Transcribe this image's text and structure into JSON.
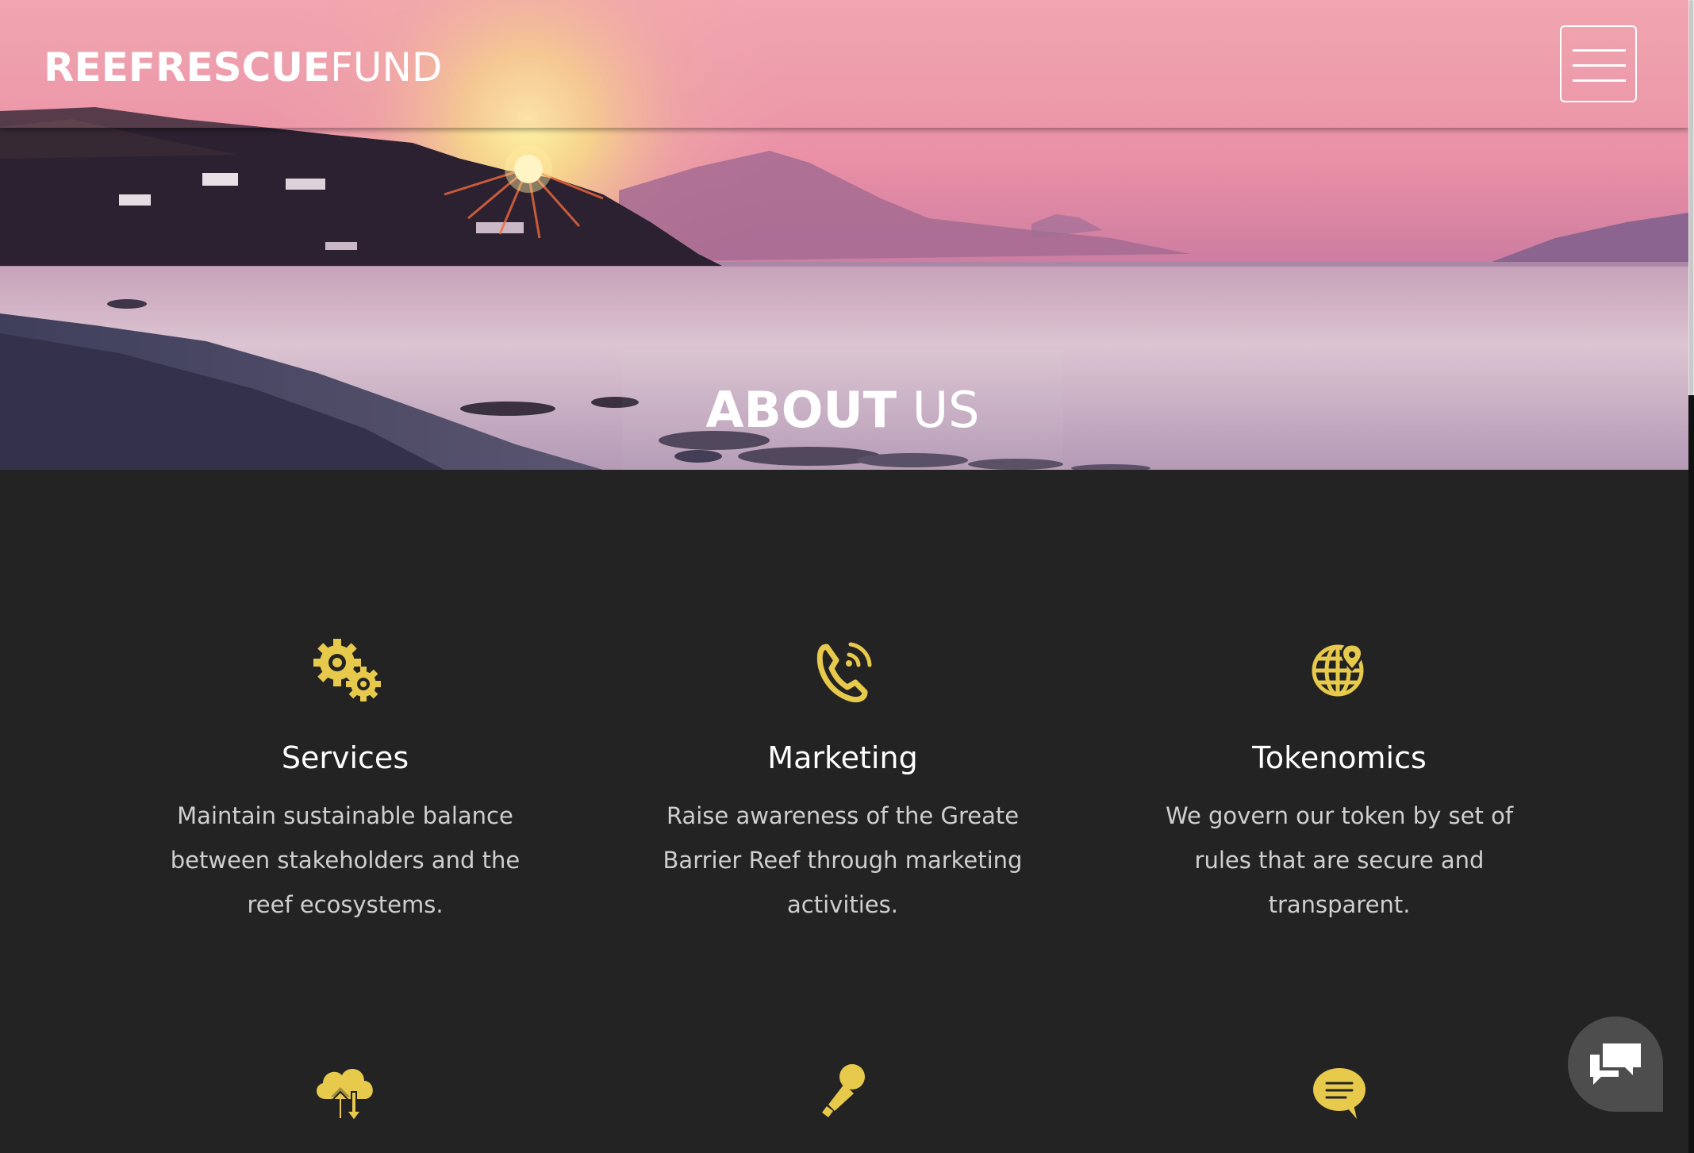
{
  "brand": {
    "logo_bold": "REEFRESCUE",
    "logo_light": "FUND"
  },
  "nav": {
    "menu_icon": "hamburger-menu-icon"
  },
  "hero": {
    "title_bold": "ABOUT",
    "title_light": " US"
  },
  "colors": {
    "accent": "#e7c94c",
    "background": "#232323",
    "heading": "#ffffff",
    "body_text": "#cfcfcf"
  },
  "features": [
    {
      "icon": "gears-icon",
      "title": "Services",
      "text": "Maintain sustainable balance between stakeholders and the reef ecosystems."
    },
    {
      "icon": "phone-ringing-icon",
      "title": "Marketing",
      "text": "Raise awareness of the Greate Barrier Reef through marketing activities."
    },
    {
      "icon": "globe-pin-icon",
      "title": "Tokenomics",
      "text": "We govern our token by set of rules that are secure and transparent."
    }
  ],
  "second_row_icons": [
    "cloud-upload-download-icon",
    "microphone-icon",
    "chat-bubble-icon"
  ],
  "chat_widget": {
    "icon": "chat-messages-icon"
  }
}
